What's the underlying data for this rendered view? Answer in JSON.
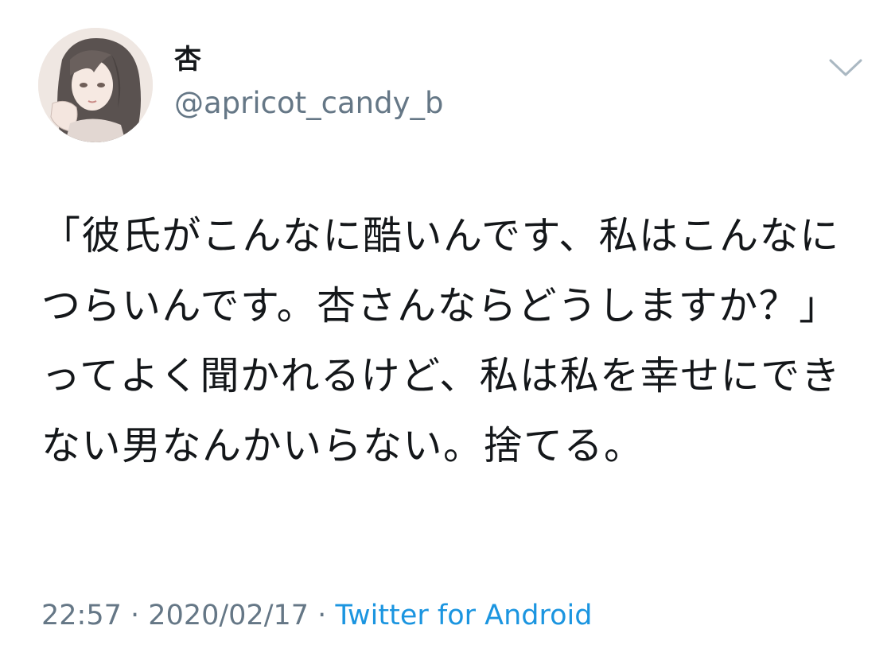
{
  "author": {
    "display_name": "杏",
    "handle": "@apricot_candy_b",
    "avatar_icon": "avatar-illustration-icon",
    "menu_icon": "chevron-down-icon"
  },
  "tweet": {
    "text": "「彼氏がこんなに酷いんです、私はこんなにつらいんです。杏さんならどうしますか？」ってよく聞かれるけど、私は私を幸せにできない男なんかいらない。捨てる。"
  },
  "meta": {
    "time": "22:57",
    "separator": "·",
    "date": "2020/02/17",
    "source": "Twitter for Android"
  },
  "colors": {
    "text": "#14171a",
    "secondary": "#657786",
    "link": "#1b95e0",
    "caret": "#aab8c2"
  }
}
